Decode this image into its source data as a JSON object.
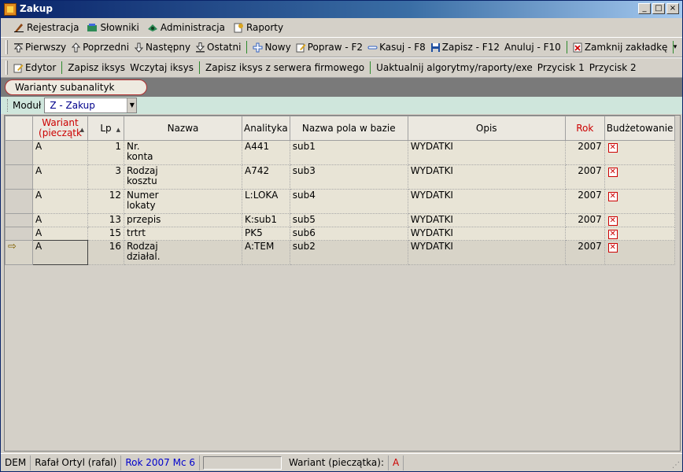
{
  "window": {
    "title": "Zakup",
    "buttons": [
      "_",
      "□",
      "×"
    ]
  },
  "menu": [
    {
      "label": "Rejestracja",
      "icon": "pen-icon",
      "color": "#8b4513"
    },
    {
      "label": "Słowniki",
      "icon": "books-icon",
      "color": "#2e8b57"
    },
    {
      "label": "Administracja",
      "icon": "gear-icon",
      "color": "#2e8b57"
    },
    {
      "label": "Raporty",
      "icon": "report-icon",
      "color": "#daa520"
    }
  ],
  "toolbar1": {
    "first": "Pierwszy",
    "prev": "Poprzedni",
    "next": "Następny",
    "last": "Ostatni",
    "new": "Nowy",
    "edit": "Popraw - F2",
    "delete": "Kasuj - F8",
    "save": "Zapisz - F12",
    "cancel": "Anuluj - F10",
    "close_tab": "Zamknij zakładkę"
  },
  "toolbar2": {
    "editor": "Edytor",
    "save_iksys": "Zapisz iksys",
    "load_iksys": "Wczytaj iksys",
    "save_iksys_server": "Zapisz iksys z serwera firmowego",
    "update": "Uaktualnij algorytmy/raporty/exe",
    "button1": "Przycisk 1",
    "button2": "Przycisk 2"
  },
  "tab": {
    "label": "Warianty subanalityk"
  },
  "module": {
    "label": "Moduł",
    "value": "Z - Zakup"
  },
  "grid": {
    "columns": [
      "Wariant (pieczątk",
      "Lp",
      "Nazwa",
      "Analityka",
      "Nazwa pola w bazie",
      "Opis",
      "Rok",
      "Budżetowanie"
    ],
    "rows": [
      {
        "wariant": "A",
        "lp": "1",
        "nazwa1": "Nr.",
        "nazwa2": "konta",
        "analityka": "A441",
        "pole": "sub1",
        "opis": "WYDATKI",
        "rok": "2007",
        "budzet": true
      },
      {
        "wariant": "A",
        "lp": "3",
        "nazwa1": "Rodzaj",
        "nazwa2": "kosztu",
        "analityka": "A742",
        "pole": "sub3",
        "opis": "WYDATKI",
        "rok": "2007",
        "budzet": true
      },
      {
        "wariant": "A",
        "lp": "12",
        "nazwa1": "Numer",
        "nazwa2": "lokaty",
        "analityka": "L:LOKA",
        "pole": "sub4",
        "opis": "WYDATKI",
        "rok": "2007",
        "budzet": true
      },
      {
        "wariant": "A",
        "lp": "13",
        "nazwa1": "przepis",
        "nazwa2": "",
        "analityka": "K:sub1",
        "pole": "sub5",
        "opis": "WYDATKI",
        "rok": "2007",
        "budzet": true
      },
      {
        "wariant": "A",
        "lp": "15",
        "nazwa1": "trtrt",
        "nazwa2": "",
        "analityka": "PK5",
        "pole": "sub6",
        "opis": "WYDATKI",
        "rok": "",
        "budzet": true
      },
      {
        "wariant": "A",
        "lp": "16",
        "nazwa1": "Rodzaj",
        "nazwa2": "działal.",
        "analityka": "A:TEM",
        "pole": "sub2",
        "opis": "WYDATKI",
        "rok": "2007",
        "budzet": true,
        "current": true
      }
    ]
  },
  "status": {
    "db": "DEM",
    "user": "Rafał Ortyl (rafal)",
    "year": "Rok 2007",
    "month": "Mc 6",
    "variant_label": "Wariant (pieczątka):",
    "variant_value": "A"
  }
}
